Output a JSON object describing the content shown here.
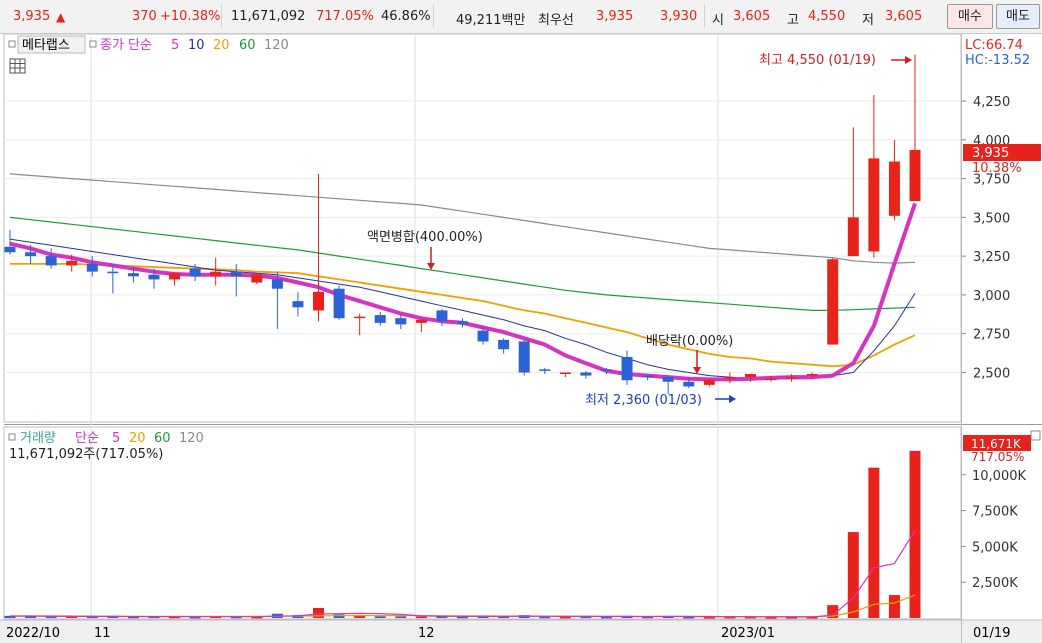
{
  "ticker": {
    "price": "3,935",
    "up_arrow": "▲",
    "change": "370",
    "change_pct": "+10.38%",
    "volume": "11,671,092",
    "volume_ratio": "717.05%",
    "turnover_pct": "46.86%",
    "trade_value": "49,211백만",
    "best_bid_label": "최우선",
    "best_ask": "3,935",
    "best_bid": "3,930",
    "open_label": "시",
    "open": "3,605",
    "high_label": "고",
    "high": "4,550",
    "low_label": "저",
    "low": "3,605",
    "buy_label": "매수",
    "sell_label": "매도"
  },
  "price_panel": {
    "name_tag": "메타랩스",
    "legend_label": "종가 단순",
    "ma_periods": [
      "5",
      "10",
      "20",
      "60",
      "120"
    ],
    "lc_label": "LC:66.74",
    "hc_label": "HC:-13.52",
    "current_price_box": "3,935",
    "current_pct": "10.38%",
    "annotation_high": "최고 4,550 (01/19)",
    "annotation_low": "최저 2,360 (01/03)",
    "annotation_split": "액면병합(400.00%)",
    "annotation_dividend": "배당락(0.00%)",
    "y_ticks": [
      "4,250",
      "4,000",
      "3,750",
      "3,500",
      "3,250",
      "3,000",
      "2,750",
      "2,500"
    ]
  },
  "volume_panel": {
    "legend_label": "거래량",
    "ma_label": "단순",
    "ma_periods": [
      "5",
      "20",
      "60",
      "120"
    ],
    "summary": "11,671,092주(717.05%)",
    "current_box": "11,671K",
    "current_pct": "717.05%",
    "y_ticks": [
      "10,000K",
      "7,500K",
      "5,000K",
      "2,500K"
    ]
  },
  "x_axis": {
    "labels": [
      "2022/10",
      "11",
      "12",
      "2023/01",
      "01/19"
    ]
  },
  "colors": {
    "up": "#e8231b",
    "down": "#2b62d6",
    "ma5": "#d633c2",
    "ma10": "#2233aa",
    "ma20": "#f0a000",
    "ma60": "#1f9a3a",
    "ma120": "#8a8a8a"
  },
  "chart_data": {
    "type": "candlestick",
    "candles": [
      {
        "o": 3310,
        "h": 3420,
        "l": 3260,
        "c": 3275
      },
      {
        "o": 3275,
        "h": 3320,
        "l": 3200,
        "c": 3250
      },
      {
        "o": 3250,
        "h": 3300,
        "l": 3170,
        "c": 3190
      },
      {
        "o": 3190,
        "h": 3260,
        "l": 3150,
        "c": 3220
      },
      {
        "o": 3200,
        "h": 3250,
        "l": 3120,
        "c": 3150
      },
      {
        "o": 3150,
        "h": 3200,
        "l": 3010,
        "c": 3140
      },
      {
        "o": 3140,
        "h": 3180,
        "l": 3080,
        "c": 3120
      },
      {
        "o": 3130,
        "h": 3170,
        "l": 3040,
        "c": 3100
      },
      {
        "o": 3100,
        "h": 3150,
        "l": 3060,
        "c": 3140
      },
      {
        "o": 3170,
        "h": 3200,
        "l": 3090,
        "c": 3120
      },
      {
        "o": 3120,
        "h": 3240,
        "l": 3060,
        "c": 3150
      },
      {
        "o": 3150,
        "h": 3200,
        "l": 2990,
        "c": 3120
      },
      {
        "o": 3080,
        "h": 3140,
        "l": 3070,
        "c": 3130
      },
      {
        "o": 3100,
        "h": 3150,
        "l": 2780,
        "c": 3040
      },
      {
        "o": 2960,
        "h": 3020,
        "l": 2860,
        "c": 2920
      },
      {
        "o": 2900,
        "h": 3780,
        "l": 2830,
        "c": 3020
      },
      {
        "o": 3040,
        "h": 3060,
        "l": 2840,
        "c": 2850
      },
      {
        "o": 2860,
        "h": 2880,
        "l": 2740,
        "c": 2860
      },
      {
        "o": 2870,
        "h": 2890,
        "l": 2800,
        "c": 2820
      },
      {
        "o": 2850,
        "h": 2870,
        "l": 2780,
        "c": 2810
      },
      {
        "o": 2820,
        "h": 2840,
        "l": 2760,
        "c": 2840
      },
      {
        "o": 2900,
        "h": 2910,
        "l": 2800,
        "c": 2830
      },
      {
        "o": 2830,
        "h": 2850,
        "l": 2790,
        "c": 2810
      },
      {
        "o": 2770,
        "h": 2790,
        "l": 2680,
        "c": 2700
      },
      {
        "o": 2710,
        "h": 2720,
        "l": 2620,
        "c": 2650
      },
      {
        "o": 2700,
        "h": 2710,
        "l": 2480,
        "c": 2500
      },
      {
        "o": 2520,
        "h": 2530,
        "l": 2490,
        "c": 2510
      },
      {
        "o": 2490,
        "h": 2500,
        "l": 2470,
        "c": 2500
      },
      {
        "o": 2500,
        "h": 2510,
        "l": 2460,
        "c": 2480
      },
      {
        "o": 2520,
        "h": 2530,
        "l": 2490,
        "c": 2510
      },
      {
        "o": 2600,
        "h": 2640,
        "l": 2420,
        "c": 2450
      },
      {
        "o": 2480,
        "h": 2490,
        "l": 2450,
        "c": 2470
      },
      {
        "o": 2470,
        "h": 2480,
        "l": 2360,
        "c": 2440
      },
      {
        "o": 2440,
        "h": 2470,
        "l": 2400,
        "c": 2410
      },
      {
        "o": 2420,
        "h": 2460,
        "l": 2410,
        "c": 2450
      },
      {
        "o": 2470,
        "h": 2500,
        "l": 2430,
        "c": 2470
      },
      {
        "o": 2470,
        "h": 2490,
        "l": 2440,
        "c": 2490
      },
      {
        "o": 2460,
        "h": 2480,
        "l": 2440,
        "c": 2460
      },
      {
        "o": 2470,
        "h": 2490,
        "l": 2440,
        "c": 2470
      },
      {
        "o": 2480,
        "h": 2500,
        "l": 2460,
        "c": 2490
      },
      {
        "o": 2680,
        "h": 3240,
        "l": 2680,
        "c": 3230
      },
      {
        "o": 3250,
        "h": 4080,
        "l": 3250,
        "c": 3500
      },
      {
        "o": 3280,
        "h": 4290,
        "l": 3240,
        "c": 3880
      },
      {
        "o": 3510,
        "h": 4000,
        "l": 3480,
        "c": 3860
      },
      {
        "o": 3605,
        "h": 4550,
        "l": 3605,
        "c": 3935
      }
    ],
    "ma5": [
      3330,
      3300,
      3260,
      3240,
      3210,
      3190,
      3170,
      3150,
      3135,
      3130,
      3130,
      3130,
      3125,
      3110,
      3080,
      3050,
      3000,
      2960,
      2920,
      2880,
      2850,
      2830,
      2820,
      2790,
      2760,
      2720,
      2680,
      2610,
      2560,
      2510,
      2490,
      2480,
      2470,
      2460,
      2455,
      2455,
      2460,
      2465,
      2470,
      2470,
      2480,
      2560,
      2800,
      3200,
      3590
    ],
    "ma10": [
      3360,
      3340,
      3320,
      3300,
      3280,
      3260,
      3240,
      3220,
      3200,
      3180,
      3160,
      3150,
      3140,
      3130,
      3110,
      3090,
      3070,
      3050,
      3020,
      2990,
      2960,
      2930,
      2900,
      2870,
      2840,
      2800,
      2770,
      2720,
      2680,
      2630,
      2590,
      2550,
      2520,
      2500,
      2480,
      2470,
      2460,
      2460,
      2460,
      2460,
      2480,
      2500,
      2640,
      2800,
      3010
    ],
    "ma20": [
      3200,
      3200,
      3200,
      3200,
      3195,
      3190,
      3185,
      3180,
      3175,
      3170,
      3165,
      3160,
      3150,
      3145,
      3140,
      3120,
      3100,
      3080,
      3060,
      3040,
      3020,
      3000,
      2980,
      2960,
      2930,
      2900,
      2880,
      2850,
      2820,
      2790,
      2760,
      2720,
      2680,
      2650,
      2620,
      2600,
      2590,
      2570,
      2560,
      2550,
      2540,
      2550,
      2610,
      2680,
      2740
    ],
    "ma60": [
      3500,
      3485,
      3470,
      3455,
      3440,
      3425,
      3410,
      3395,
      3380,
      3365,
      3350,
      3335,
      3320,
      3305,
      3290,
      3270,
      3250,
      3230,
      3210,
      3190,
      3170,
      3150,
      3130,
      3110,
      3090,
      3070,
      3050,
      3030,
      3015,
      3000,
      2990,
      2980,
      2970,
      2960,
      2950,
      2940,
      2930,
      2920,
      2910,
      2900,
      2900,
      2905,
      2910,
      2915,
      2920
    ],
    "ma120": [
      3780,
      3770,
      3760,
      3750,
      3740,
      3730,
      3720,
      3710,
      3700,
      3690,
      3680,
      3670,
      3660,
      3650,
      3640,
      3630,
      3620,
      3610,
      3600,
      3590,
      3580,
      3560,
      3540,
      3520,
      3500,
      3480,
      3460,
      3440,
      3420,
      3400,
      3380,
      3360,
      3340,
      3320,
      3300,
      3290,
      3280,
      3270,
      3260,
      3250,
      3240,
      3220,
      3210,
      3205,
      3210
    ],
    "volume": [
      150,
      120,
      100,
      110,
      100,
      110,
      90,
      100,
      90,
      80,
      100,
      90,
      80,
      300,
      200,
      700,
      250,
      150,
      120,
      110,
      100,
      120,
      90,
      110,
      100,
      200,
      90,
      80,
      100,
      80,
      150,
      90,
      130,
      80,
      70,
      80,
      80,
      60,
      70,
      70,
      900,
      6000,
      10500,
      1600,
      11671
    ],
    "vol_ma5": [
      130,
      130,
      120,
      115,
      110,
      110,
      100,
      100,
      95,
      90,
      90,
      90,
      90,
      140,
      150,
      280,
      300,
      320,
      300,
      250,
      150,
      120,
      110,
      110,
      105,
      130,
      120,
      110,
      110,
      110,
      110,
      100,
      110,
      105,
      100,
      90,
      90,
      80,
      80,
      70,
      200,
      1400,
      3500,
      3800,
      6100
    ],
    "vol_ma20": [
      150,
      150,
      145,
      140,
      135,
      130,
      125,
      120,
      115,
      110,
      110,
      110,
      110,
      120,
      125,
      150,
      160,
      165,
      170,
      170,
      165,
      160,
      150,
      145,
      140,
      140,
      135,
      130,
      125,
      120,
      120,
      115,
      115,
      110,
      105,
      100,
      100,
      100,
      95,
      95,
      130,
      420,
      950,
      1050,
      1600
    ],
    "price_ylim": [
      2200,
      4650
    ],
    "volume_ylim": [
      0,
      12500
    ]
  }
}
